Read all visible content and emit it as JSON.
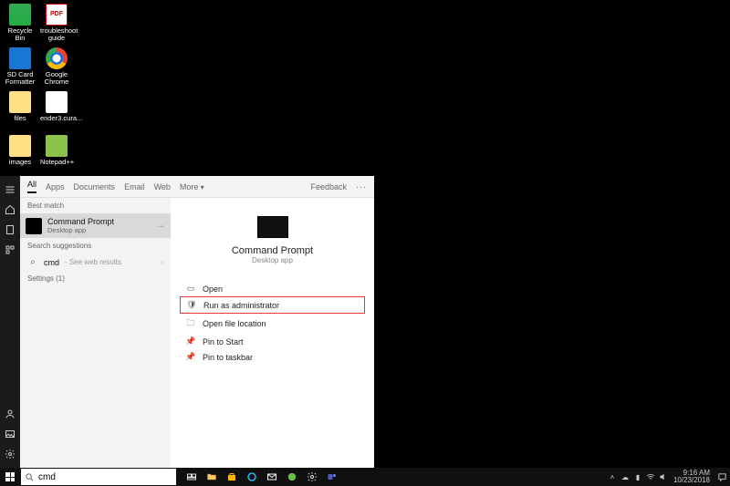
{
  "desktop_icons": [
    {
      "name": "recycle-bin",
      "label": "Recycle Bin",
      "cls": "recycle"
    },
    {
      "name": "troubleshoot-guide",
      "label": "troubleshoot guide",
      "cls": "pdf"
    },
    {
      "name": "sd-formatter",
      "label": "SD Card Formatter",
      "cls": "sd"
    },
    {
      "name": "google-chrome",
      "label": "Google Chrome",
      "cls": "chrome"
    },
    {
      "name": "files",
      "label": "files",
      "cls": "files"
    },
    {
      "name": "ender3-cura",
      "label": "ender3.cura...",
      "cls": "cura"
    },
    {
      "name": "images",
      "label": "images",
      "cls": "images"
    },
    {
      "name": "notepadpp",
      "label": "Notepad++",
      "cls": "npp"
    }
  ],
  "search": {
    "input_value": "cmd",
    "tabs": {
      "all": "All",
      "apps": "Apps",
      "documents": "Documents",
      "email": "Email",
      "web": "Web",
      "more": "More",
      "feedback": "Feedback"
    },
    "left": {
      "best_match_header": "Best match",
      "best_match_title": "Command Prompt",
      "best_match_sub": "Desktop app",
      "search_suggestions_header": "Search suggestions",
      "cmd_text": "cmd",
      "cmd_sub": "- See web results",
      "settings_header": "Settings (1)"
    },
    "right": {
      "title": "Command Prompt",
      "sub": "Desktop app",
      "actions": {
        "open": "Open",
        "run_admin": "Run as administrator",
        "open_loc": "Open file location",
        "pin_start": "Pin to Start",
        "pin_task": "Pin to taskbar"
      }
    }
  },
  "taskbar": {
    "time": "9:16 AM",
    "date": "10/23/2018"
  }
}
